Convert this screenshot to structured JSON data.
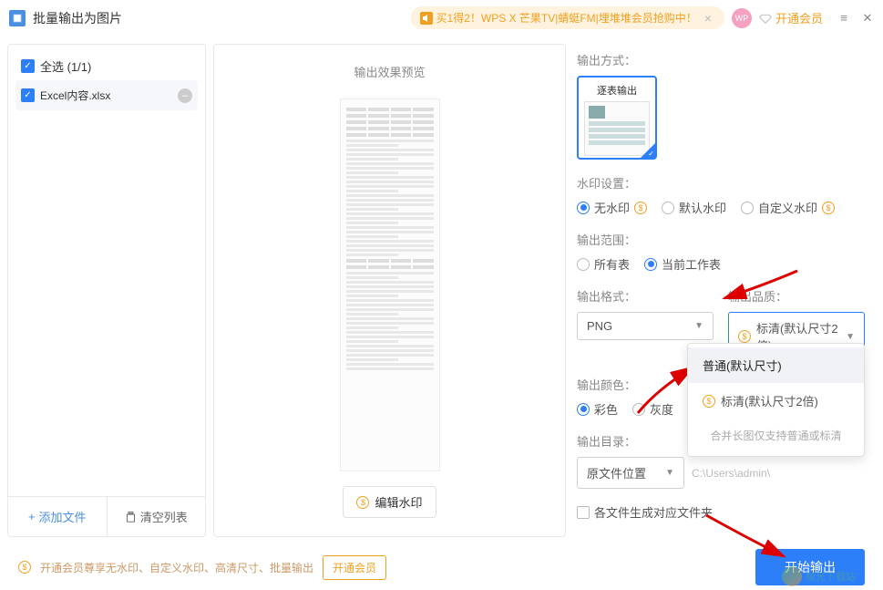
{
  "header": {
    "title": "批量输出为图片",
    "promo": "买1得2！WPS X 芒果TV|蜻蜓FM|埋堆堆会员抢购中！",
    "avatar_text": "WP",
    "vip_link": "开通会员"
  },
  "left": {
    "select_all": "全选 (1/1)",
    "files": [
      {
        "name": "Excel内容.xlsx"
      }
    ],
    "add_file": "添加文件",
    "clear_list": "清空列表"
  },
  "preview": {
    "title": "输出效果预览",
    "edit_watermark": "编辑水印"
  },
  "settings": {
    "output_mode": {
      "label": "输出方式：",
      "card_title": "逐表输出"
    },
    "watermark": {
      "label": "水印设置：",
      "options": [
        "无水印",
        "默认水印",
        "自定义水印"
      ],
      "selected": 0
    },
    "range": {
      "label": "输出范围：",
      "options": [
        "所有表",
        "当前工作表"
      ],
      "selected": 1
    },
    "format": {
      "label": "输出格式：",
      "value": "PNG"
    },
    "quality": {
      "label": "输出品质：",
      "value": "标清(默认尺寸2倍)",
      "dropdown": {
        "opt1": "普通(默认尺寸)",
        "opt2": "标清(默认尺寸2倍)",
        "hint": "合并长图仅支持普通或标清"
      }
    },
    "color": {
      "label": "输出颜色：",
      "options": [
        "彩色",
        "灰度"
      ],
      "selected": 0
    },
    "dir": {
      "label": "输出目录：",
      "value": "原文件位置",
      "path": "C:\\Users\\admin\\"
    },
    "subfolder": "各文件生成对应文件夹"
  },
  "footer": {
    "tip": "开通会员尊享无水印、自定义水印、高清尺寸、批量输出",
    "vip_btn": "开通会员",
    "start_btn": "开始输出"
  },
  "watermark_site": "极光下载站"
}
